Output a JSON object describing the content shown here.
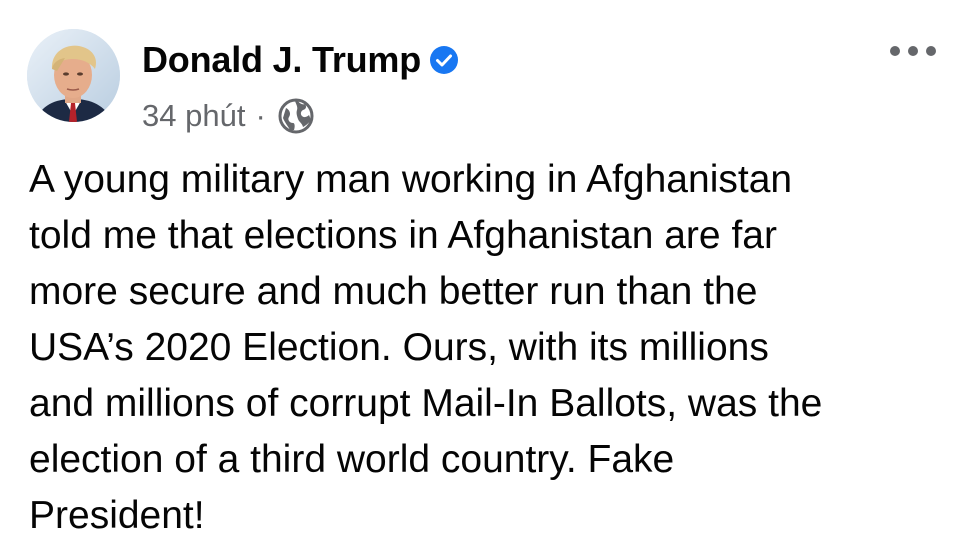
{
  "post": {
    "author": {
      "name": "Donald J. Trump",
      "verified": true,
      "verified_color": "#1877f2"
    },
    "meta": {
      "timestamp": "34 phút",
      "separator": "·",
      "audience_icon": "globe-icon"
    },
    "menu_icon": "more-options-icon",
    "body_lines": [
      "A young military man working in Afghanistan",
      "told me that elections in Afghanistan are far",
      "more secure and much better run than the",
      "USA’s 2020 Election. Ours, with its millions",
      "and millions of corrupt Mail-In Ballots, was the",
      "election of a third world country. Fake",
      "President!"
    ]
  },
  "colors": {
    "text": "#050505",
    "secondary": "#65676b",
    "background": "#ffffff"
  }
}
